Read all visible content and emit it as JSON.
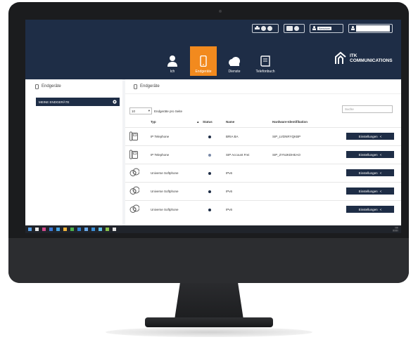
{
  "header": {
    "top_buttons": [
      {
        "icon": "printer-icon"
      },
      {
        "icon": "mail-icon"
      },
      {
        "icon": "user-icon",
        "label": "Benutzer"
      },
      {
        "icon": "user-icon"
      }
    ],
    "nav": [
      {
        "label": "Ich",
        "icon": "person-icon",
        "active": false
      },
      {
        "label": "Endgeräte",
        "icon": "phone-icon",
        "active": true
      },
      {
        "label": "Dienste",
        "icon": "cloud-icon",
        "active": false
      },
      {
        "label": "Telefonbuch",
        "icon": "book-icon",
        "active": false
      }
    ],
    "logo": {
      "line1": "ITK",
      "line2": "COMMUNICATIONS"
    }
  },
  "sidebar": {
    "title": "Endgeräte",
    "items": [
      {
        "label": "MEINE ENDGERÄTE"
      }
    ]
  },
  "main": {
    "title": "Endgeräte",
    "page_size": "10",
    "page_size_label": "Endgeräte pro Seite",
    "search_placeholder": "Suche",
    "columns": [
      "Typ",
      "Status",
      "Name",
      "Hardware-Identifikation"
    ],
    "rows": [
      {
        "icon": "desk-phone-icon",
        "type": "IP Telephone",
        "status": "online",
        "name": "BRIA BA",
        "hw": "SIP_LVDNRYQKBP",
        "action": "Einstellungen"
      },
      {
        "icon": "desk-phone-icon",
        "type": "IP Telephone",
        "status": "offline",
        "name": "SIP Account Frei",
        "hw": "SIP_ZYNJKDHEAO",
        "action": "Einstellungen"
      },
      {
        "icon": "softphone-icon",
        "type": "Universe Softphone",
        "status": "online",
        "name": "IPv6",
        "hw": "",
        "action": "Einstellungen"
      },
      {
        "icon": "softphone-icon",
        "type": "Universe Softphone",
        "status": "online",
        "name": "IPv6",
        "hw": "",
        "action": "Einstellungen"
      },
      {
        "icon": "softphone-icon",
        "type": "Universe Softphone",
        "status": "online",
        "name": "IPv6",
        "hw": "",
        "action": "Einstellungen"
      }
    ]
  },
  "colors": {
    "navy": "#1e2d46",
    "accent": "#f28a1e"
  }
}
